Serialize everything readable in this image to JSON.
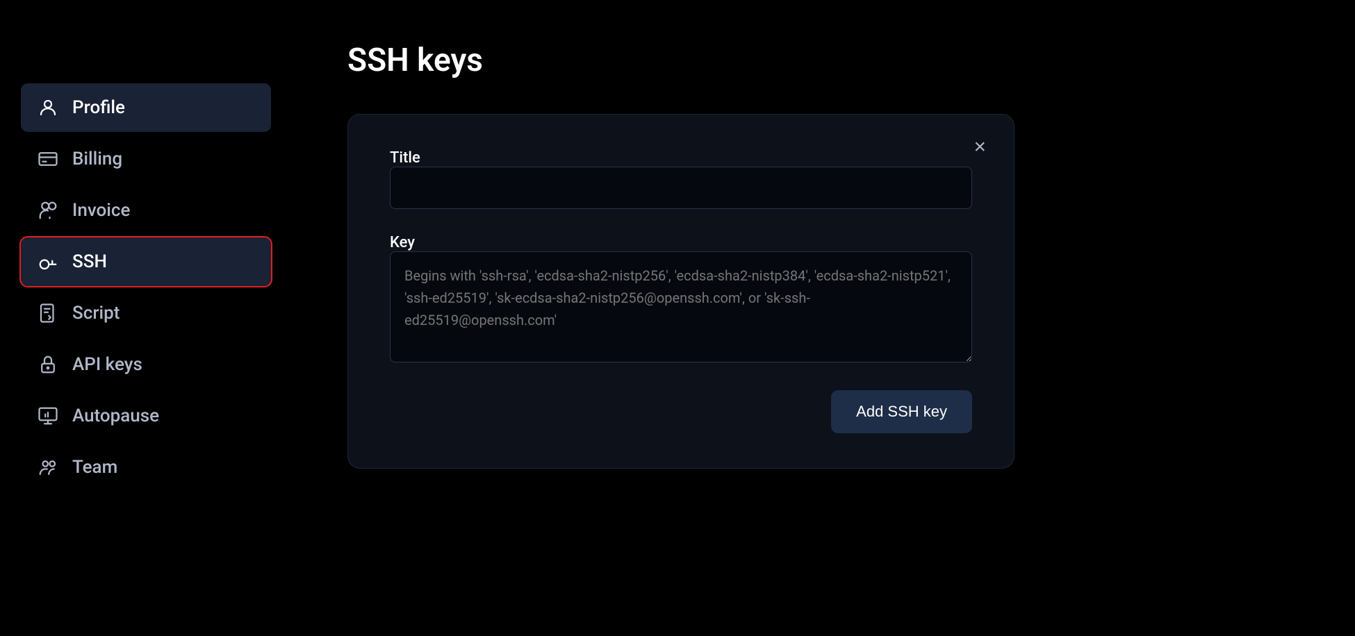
{
  "page": {
    "title": "SSH keys"
  },
  "sidebar": {
    "items": [
      {
        "id": "profile",
        "label": "Profile",
        "icon": "user",
        "active": true,
        "selected": false
      },
      {
        "id": "billing",
        "label": "Billing",
        "icon": "billing",
        "active": false,
        "selected": false
      },
      {
        "id": "invoice",
        "label": "Invoice",
        "icon": "invoice",
        "active": false,
        "selected": false
      },
      {
        "id": "ssh",
        "label": "SSH",
        "icon": "key",
        "active": false,
        "selected": true
      },
      {
        "id": "script",
        "label": "Script",
        "icon": "script",
        "active": false,
        "selected": false
      },
      {
        "id": "api-keys",
        "label": "API keys",
        "icon": "lock",
        "active": false,
        "selected": false
      },
      {
        "id": "autopause",
        "label": "Autopause",
        "icon": "monitor",
        "active": false,
        "selected": false
      },
      {
        "id": "team",
        "label": "Team",
        "icon": "team",
        "active": false,
        "selected": false
      }
    ]
  },
  "card": {
    "title_label": "Title",
    "title_placeholder": "",
    "key_label": "Key",
    "key_placeholder": "Begins with 'ssh-rsa', 'ecdsa-sha2-nistp256', 'ecdsa-sha2-nistp384', 'ecdsa-sha2-nistp521', 'ssh-ed25519', 'sk-ecdsa-sha2-nistp256@openssh.com', or 'sk-ssh-ed25519@openssh.com'",
    "add_button_label": "Add SSH key",
    "close_label": "×"
  }
}
